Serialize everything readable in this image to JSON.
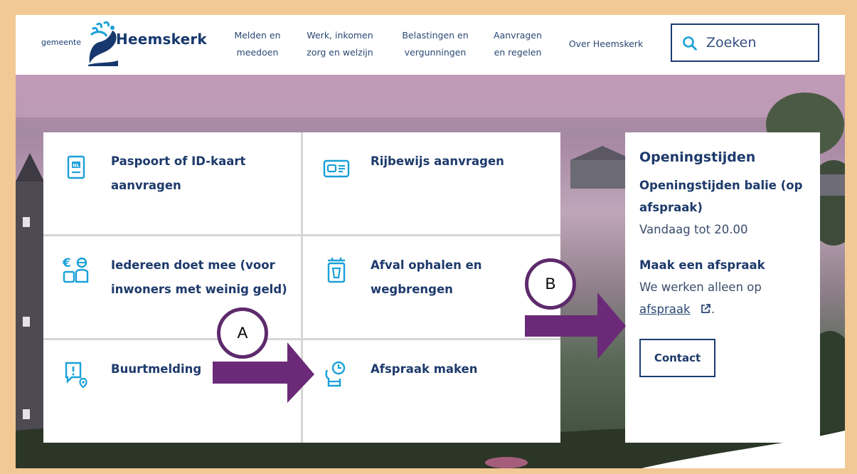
{
  "header": {
    "logo_prefix": "gemeente",
    "logo_name": "Heemskerk",
    "nav": [
      {
        "line1": "Melden en",
        "line2": "meedoen"
      },
      {
        "line1": "Werk, inkomen",
        "line2": "zorg en welzijn"
      },
      {
        "line1": "Belastingen en",
        "line2": "vergunningen"
      },
      {
        "line1": "Aanvragen",
        "line2": "en regelen"
      },
      {
        "line1": "Over Heemskerk",
        "line2": ""
      }
    ],
    "search_placeholder": "Zoeken"
  },
  "cards": [
    {
      "label": "Paspoort of ID-kaart aanvragen",
      "icon": "passport-icon"
    },
    {
      "label": "Rijbewijs aanvragen",
      "icon": "drivers-license-icon"
    },
    {
      "label": "Iedereen doet mee (voor inwoners met weinig geld)",
      "icon": "money-people-icon"
    },
    {
      "label": "Afval ophalen en wegbrengen",
      "icon": "trash-bin-icon"
    },
    {
      "label": "Buurtmelding",
      "icon": "report-location-icon"
    },
    {
      "label": "Afspraak maken",
      "icon": "appointment-clock-icon"
    }
  ],
  "panel": {
    "title": "Openingstijden",
    "balie_title": "Openingstijden balie (op afspraak)",
    "balie_text": "Vandaag tot 20.00",
    "afspraak_title": "Maak een afspraak",
    "afspraak_text": "We werken alleen op",
    "afspraak_link": "afspraak",
    "afspraak_period": ".",
    "contact_label": "Contact"
  },
  "annotations": {
    "a_label": "A",
    "b_label": "B",
    "arrow_color": "#6b2a78"
  },
  "colors": {
    "brand": "#1d3a6b",
    "icon_accent": "#1aa0d8",
    "frame": "#f2c894"
  }
}
